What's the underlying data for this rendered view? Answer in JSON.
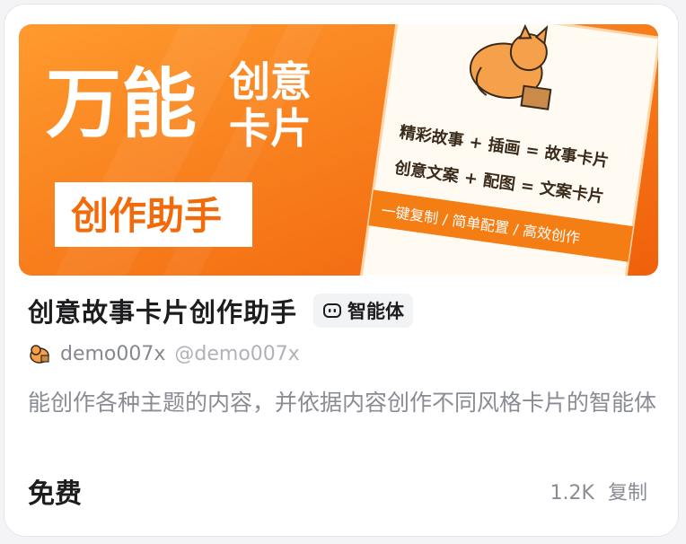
{
  "banner": {
    "headline_big": "万能",
    "headline_line1": "创意",
    "headline_line2": "卡片",
    "subtitle": "创作助手",
    "formula1": "精彩故事 + 插画 = 故事卡片",
    "formula2": "创意文案 + 配图 = 文案卡片",
    "strip": "一键复制 / 简单配置 / 高效创作",
    "illustration": "orange-cat-illustration",
    "colors": {
      "gradient_start": "#ff8a1c",
      "gradient_end": "#f26a0a",
      "phone_card": "#fffaf2",
      "strip": "#f47d14"
    }
  },
  "card": {
    "title": "创意故事卡片创作助手",
    "badge_label": "智能体",
    "badge_icon": "bot-face-icon",
    "author_name": "demo007x",
    "author_handle": "@demo007x",
    "description": "能创作各种主题的内容，并依据内容创作不同风格卡片的智能体",
    "price": "免费",
    "usage_count": "1.2K",
    "copy_label": "复制"
  }
}
